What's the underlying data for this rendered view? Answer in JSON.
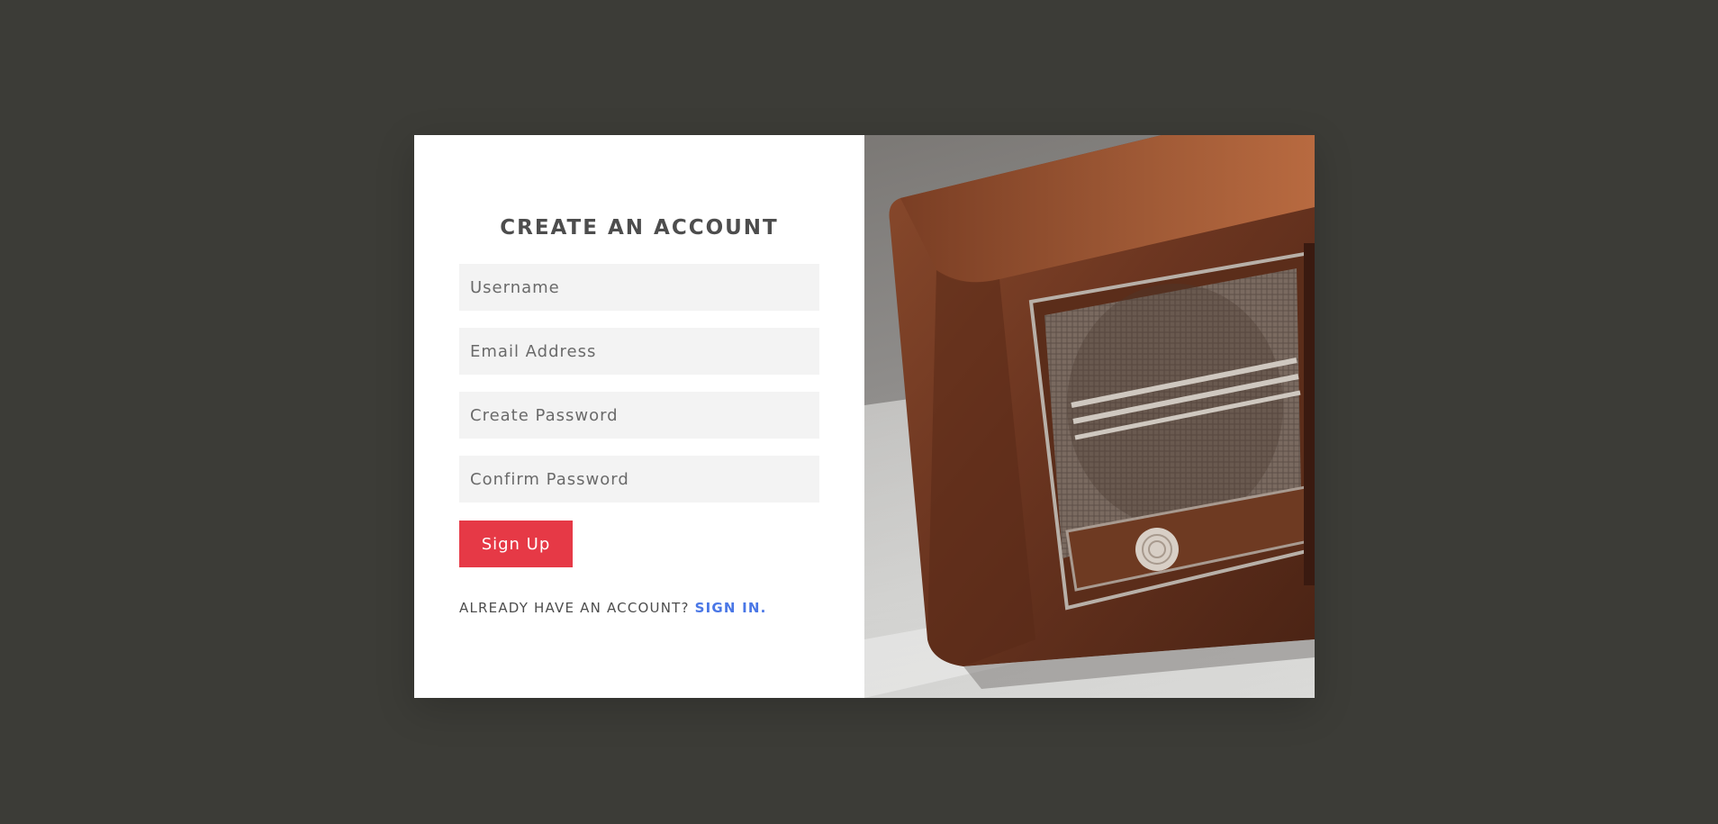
{
  "form": {
    "title": "CREATE AN ACCOUNT",
    "fields": [
      {
        "placeholder": "Username",
        "value": ""
      },
      {
        "placeholder": "Email Address",
        "value": ""
      },
      {
        "placeholder": "Create Password",
        "value": ""
      },
      {
        "placeholder": "Confirm Password",
        "value": ""
      }
    ],
    "submit_label": "Sign Up",
    "signin_prompt": "ALREADY HAVE AN ACCOUNT?",
    "signin_link": "SIGN IN."
  },
  "image": {
    "subject": "vintage wooden radio photograph"
  },
  "colors": {
    "background": "#3c3c37",
    "button": "#e63946",
    "link": "#4a77e6",
    "field_bg": "#f3f3f3",
    "title": "#4d4d4d"
  }
}
